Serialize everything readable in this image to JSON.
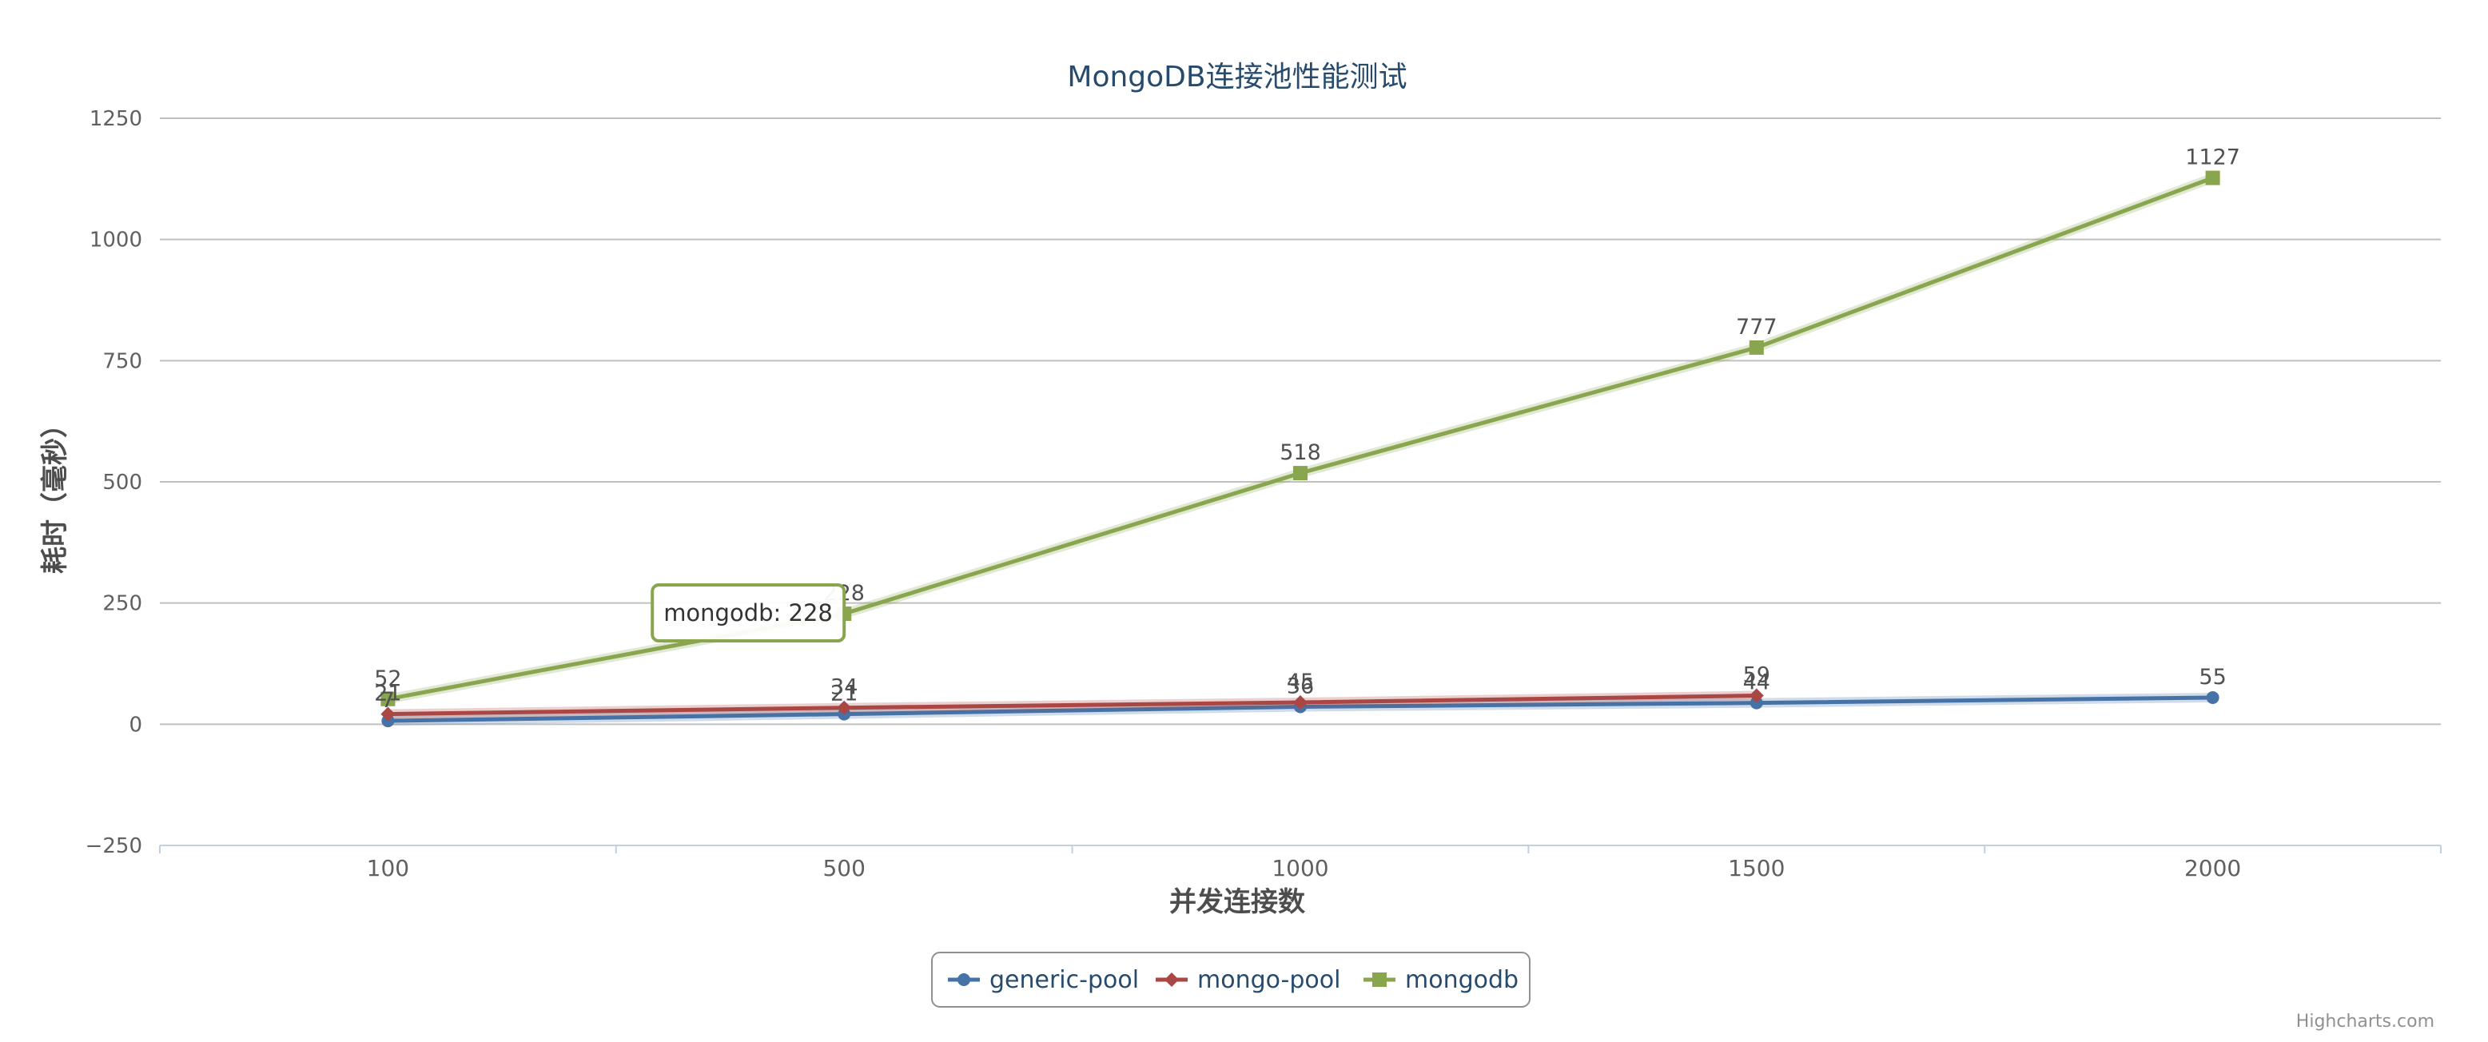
{
  "chart_data": {
    "type": "line",
    "title": "MongoDB连接池性能测试",
    "xlabel": "并发连接数",
    "ylabel": "耗时（毫秒）",
    "categories": [
      "100",
      "500",
      "1000",
      "1500",
      "2000"
    ],
    "ylim": [
      -250,
      1250
    ],
    "yticks": [
      -250,
      0,
      250,
      500,
      750,
      1000,
      1250
    ],
    "grid": true,
    "legend_position": "bottom-center",
    "series": [
      {
        "name": "generic-pool",
        "marker": "circle",
        "color": "#4572A7",
        "values": [
          7,
          21,
          36,
          44,
          55
        ]
      },
      {
        "name": "mongo-pool",
        "marker": "diamond",
        "color": "#AA4643",
        "values": [
          21,
          34,
          45,
          59,
          null
        ]
      },
      {
        "name": "mongodb",
        "marker": "square",
        "color": "#89A54E",
        "values": [
          52,
          228,
          518,
          777,
          1127
        ]
      }
    ],
    "tooltip": {
      "series": "mongodb",
      "category": "500",
      "text": "mongodb: 228"
    },
    "credits": "Highcharts.com"
  }
}
